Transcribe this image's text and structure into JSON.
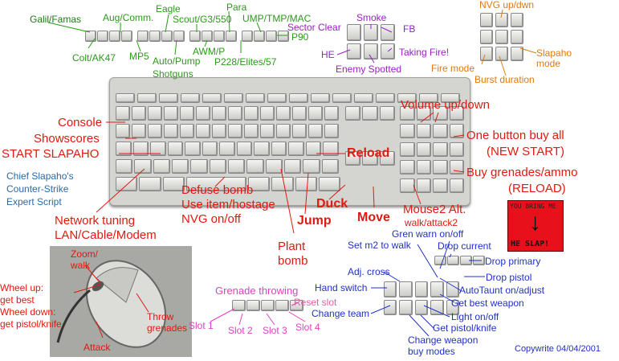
{
  "labels": {
    "galil": "Galil/Famas",
    "aug": "Aug/Comm.",
    "eagle": "Eagle",
    "para": "Para",
    "scout": "Scout/G3/550",
    "ump": "UMP/TMP/MAC",
    "colt": "Colt/AK47",
    "mp5": "MP5",
    "auto_pump": "Auto/Pump",
    "shotguns": "Shotguns",
    "awm": "AWM/P",
    "p228": "P228/Elites/57",
    "p90": "P90",
    "sector_clear": "Sector Clear",
    "smoke": "Smoke",
    "fb": "FB",
    "he": "HE",
    "taking_fire": "Taking Fire!",
    "enemy_spotted": "Enemy Spotted",
    "nvg": "NVG up/dwn",
    "fire_mode": "Fire mode",
    "slapaho_mode": "Slapaho\nmode",
    "burst": "Burst duration",
    "volume": "Volume up/down",
    "console": "Console",
    "showscores": "Showscores",
    "start": "START SLAPAHO",
    "reload": "Reload",
    "one_button": "One button buy all",
    "new_start": "(NEW START)",
    "buy_grenades": "Buy grenades/ammo",
    "reload_paren": "(RELOAD)",
    "chief": "Chief Slapaho's\nCounter-Strike\nExpert Script",
    "network": "Network tuning\nLAN/Cable/Modem",
    "defuse": "Defuse bomb\nUse item/hostage\nNVG on/off",
    "plant": "Plant\nbomb",
    "jump": "Jump",
    "duck": "Duck",
    "move": "Move",
    "mouse2": "Mouse2 Alt.",
    "mouse2b": "walk/attack2",
    "zoom": "Zoom/\nwalk",
    "wheel": "Wheel up:\nget best\nWheel down:\nget pistol/knife",
    "throw": "Throw\ngrenades",
    "attack": "Attack",
    "grenade_throwing": "Grenade throwing",
    "reset_slot": "Reset slot",
    "slot1": "Slot 1",
    "slot2": "Slot 2",
    "slot3": "Slot 3",
    "slot4": "Slot 4",
    "gren_warn": "Gren warn on/off",
    "set_m2": "Set m2 to walk",
    "drop_current": "Drop current",
    "drop_primary": "Drop primary",
    "adj_cross": "Adj. cross",
    "drop_pistol": "Drop pistol",
    "hand_switch": "Hand switch",
    "autotaunt": "AutoTaunt on/adjust",
    "get_best": "Get best weapon",
    "change_team": "Change team",
    "light": "Light on/off",
    "get_pistol": "Get pistol/knife",
    "change_weapon": "Change weapon\nbuy modes",
    "copyright": "Copywrite 04/04/2001"
  },
  "slap_image": {
    "text_top": "YOU BRING ME",
    "text_bottom": "HE SLAP!",
    "arrow": "↓"
  },
  "colors": {
    "green": "#2a9a18",
    "red": "#e01a10",
    "purple": "#9a20c8",
    "orange": "#e07a10",
    "blue": "#2030c8",
    "magenta": "#e040c0"
  }
}
